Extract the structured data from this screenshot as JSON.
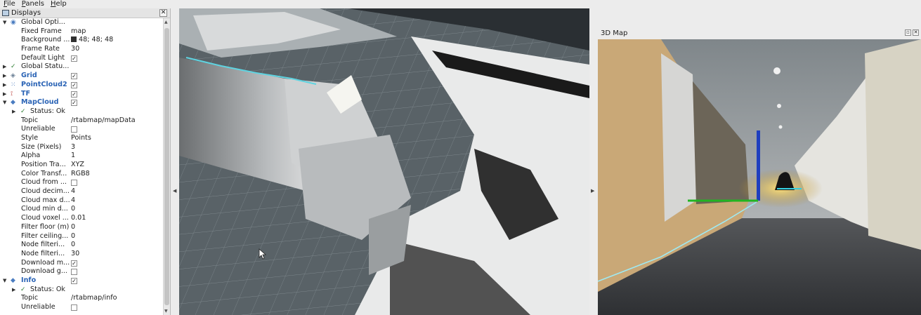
{
  "menubar": {
    "items": [
      {
        "accel": "F",
        "rest": "ile"
      },
      {
        "accel": "P",
        "rest": "anels"
      },
      {
        "accel": "H",
        "rest": "elp"
      }
    ]
  },
  "displays": {
    "title": "Displays",
    "close_glyph": "✕",
    "rows": {
      "global_options": {
        "label": "Global Opti...",
        "arrow": "▼"
      },
      "fixed_frame": {
        "label": "Fixed Frame",
        "value": "map"
      },
      "background": {
        "label": "Background ...",
        "value": "48; 48; 48"
      },
      "frame_rate": {
        "label": "Frame Rate",
        "value": "30"
      },
      "default_light": {
        "label": "Default Light",
        "check": "✓"
      },
      "global_status": {
        "label": "Global Statu...",
        "arrow": "▶",
        "icon": "✓"
      },
      "grid": {
        "label": "Grid",
        "arrow": "▶",
        "check": "✓"
      },
      "pointcloud2": {
        "label": "PointCloud2",
        "arrow": "▶",
        "check": "✓"
      },
      "tf": {
        "label": "TF",
        "arrow": "▶",
        "check": "✓"
      },
      "mapcloud": {
        "label": "MapCloud",
        "arrow": "▼",
        "check": "✓"
      },
      "mapcloud_status": {
        "label": "Status: Ok",
        "arrow": "▶",
        "icon": "✓"
      },
      "topic": {
        "label": "Topic",
        "value": "/rtabmap/mapData"
      },
      "unreliable": {
        "label": "Unreliable"
      },
      "style": {
        "label": "Style",
        "value": "Points"
      },
      "size_pixels": {
        "label": "Size (Pixels)",
        "value": "3"
      },
      "alpha": {
        "label": "Alpha",
        "value": "1"
      },
      "position_transformer": {
        "label": "Position Tra...",
        "value": "XYZ"
      },
      "color_transformer": {
        "label": "Color Transf...",
        "value": "RGB8"
      },
      "cloud_from": {
        "label": "Cloud from ..."
      },
      "cloud_decimation": {
        "label": "Cloud decim...",
        "value": "4"
      },
      "cloud_max_depth": {
        "label": "Cloud max d...",
        "value": "4"
      },
      "cloud_min_depth": {
        "label": "Cloud min d...",
        "value": "0"
      },
      "cloud_voxel": {
        "label": "Cloud voxel ...",
        "value": "0.01"
      },
      "filter_floor": {
        "label": "Filter floor (m)",
        "value": "0"
      },
      "filter_ceiling": {
        "label": "Filter ceiling...",
        "value": "0"
      },
      "node_filtering_1": {
        "label": "Node filteri...",
        "value": "0"
      },
      "node_filtering_2": {
        "label": "Node filteri...",
        "value": "30"
      },
      "download_map": {
        "label": "Download m...",
        "check": "✓"
      },
      "download_graph": {
        "label": "Download g..."
      },
      "info": {
        "label": "Info",
        "arrow": "▼",
        "check": "✓"
      },
      "info_status": {
        "label": "Status: Ok",
        "arrow": "▶",
        "icon": "✓"
      },
      "info_topic": {
        "label": "Topic",
        "value": "/rtabmap/info"
      },
      "info_unreliable": {
        "label": "Unreliable"
      }
    }
  },
  "splitters": {
    "left_glyph": "◀",
    "right_glyph": "▶"
  },
  "map_panel": {
    "title": "3D Map",
    "float_glyph": "▫",
    "close_glyph": "✕"
  },
  "icons": {
    "displays": "monitor-icon",
    "global_options": "globe-icon",
    "grid": "grid-icon",
    "pointcloud2": "pointcloud-icon",
    "tf": "tf-axes-icon",
    "mapcloud": "diamond-icon",
    "info": "diamond-icon"
  },
  "colors": {
    "viewport_background": "#303030",
    "property_link": "#2a63b5",
    "status_ok": "#2e7d32"
  }
}
